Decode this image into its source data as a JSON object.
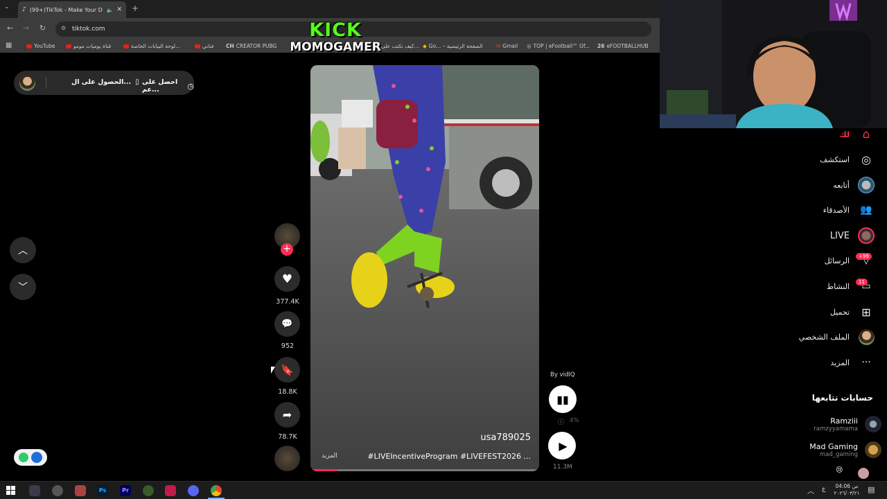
{
  "browser": {
    "tab_title": "(99+)TikTok - Make Your D...",
    "url": "tiktok.com",
    "bookmarks": [
      {
        "label": "YouTube"
      },
      {
        "label": "قناة يوميات مومو"
      },
      {
        "label": "لوحة البيانات الخاصة..."
      },
      {
        "label": "فناني"
      },
      {
        "label": "CREATOR PUBG"
      },
      {
        "label": "كيف تكتب على..."
      },
      {
        "label": "Go... – الصفحة الرئيسية"
      },
      {
        "label": "Gmail"
      },
      {
        "label": "TOP | eFootball™ Of..."
      },
      {
        "label": "eFOOTBALLHUB"
      }
    ]
  },
  "overlay": {
    "kick_line1": "KICK",
    "kick_line2": "MOMOGAMER"
  },
  "top_pill": {
    "item1": "احصل على عم...",
    "item2": "الحصول على ال..."
  },
  "video": {
    "username": "usa789025",
    "caption": "#LIVEIncentiveProgram #LIVEFEST2026 ...",
    "more_label": "المزيد",
    "progress_percent": 12
  },
  "actions": {
    "likes": "377.4K",
    "comments": "952",
    "saves": "18.8K",
    "shares": "78.7K"
  },
  "vidiq": {
    "by_label": "By vidIQ",
    "percent": "4%",
    "views": "11.3M"
  },
  "sidebar": {
    "items": [
      {
        "label": "لك",
        "icon": "home-icon"
      },
      {
        "label": "استكشف",
        "icon": "compass-icon"
      },
      {
        "label": "أتابعه",
        "icon": "following-avatar"
      },
      {
        "label": "الأصدقاء",
        "icon": "friends-icon"
      },
      {
        "label": "LIVE",
        "icon": "live-avatar"
      },
      {
        "label": "الرسائل",
        "icon": "messages-icon",
        "badge": "+99"
      },
      {
        "label": "النشاط",
        "icon": "activity-icon",
        "badge": "11"
      },
      {
        "label": "تحميل",
        "icon": "upload-icon"
      },
      {
        "label": "الملف الشخصي",
        "icon": "profile-avatar"
      },
      {
        "label": "المزيد",
        "icon": "more-icon"
      }
    ],
    "following_title": "حسابات تتابعها",
    "accounts": [
      {
        "name": "Ramziii",
        "handle": "ramzyyamama"
      },
      {
        "name": "Mad Gaming",
        "handle": "mad_gaming"
      }
    ]
  },
  "taskbar": {
    "time": "04:06 ص",
    "date": "٢٠٢٦/٠٣/٢١",
    "lang": "ع"
  },
  "colors": {
    "accent": "#fe2c55",
    "kick_green": "#53fc18",
    "bg": "#000000"
  }
}
